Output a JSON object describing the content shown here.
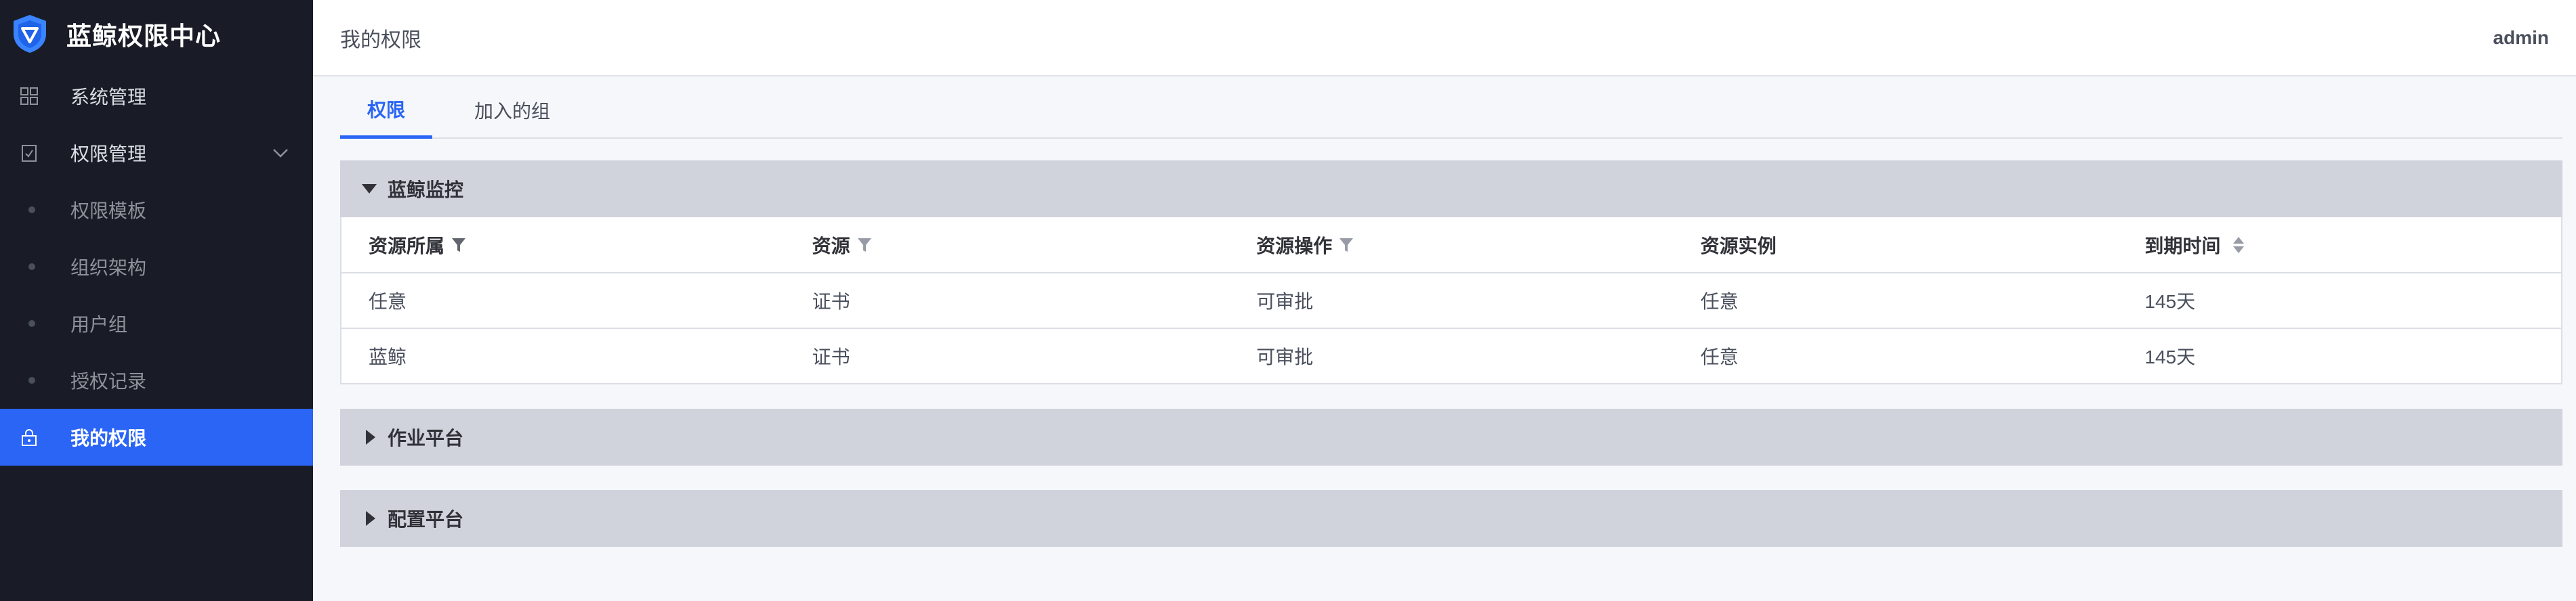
{
  "app": {
    "title": "蓝鲸权限中心"
  },
  "sidebar": {
    "items": [
      {
        "label": "系统管理",
        "icon": "grid-icon"
      },
      {
        "label": "权限管理",
        "icon": "clipboard-icon",
        "expanded": true
      },
      {
        "label": "权限模板"
      },
      {
        "label": "组织架构"
      },
      {
        "label": "用户组"
      },
      {
        "label": "授权记录"
      },
      {
        "label": "我的权限",
        "icon": "lock-icon",
        "active": true
      }
    ]
  },
  "header": {
    "title": "我的权限",
    "user": "admin"
  },
  "tabs": [
    {
      "label": "权限",
      "active": true
    },
    {
      "label": "加入的组"
    }
  ],
  "table": {
    "columns": [
      "资源所属",
      "资源",
      "资源操作",
      "资源实例",
      "到期时间"
    ]
  },
  "panels": [
    {
      "title": "蓝鲸监控",
      "expanded": true,
      "rows": [
        [
          "任意",
          "证书",
          "可审批",
          "任意",
          "145天"
        ],
        [
          "蓝鲸",
          "证书",
          "可审批",
          "任意",
          "145天"
        ]
      ]
    },
    {
      "title": "作业平台",
      "expanded": false
    },
    {
      "title": "配置平台",
      "expanded": false
    }
  ],
  "colors": {
    "accent": "#2a65f5",
    "sidebar_bg": "#191c26",
    "panel_head": "#d0d3dc"
  }
}
